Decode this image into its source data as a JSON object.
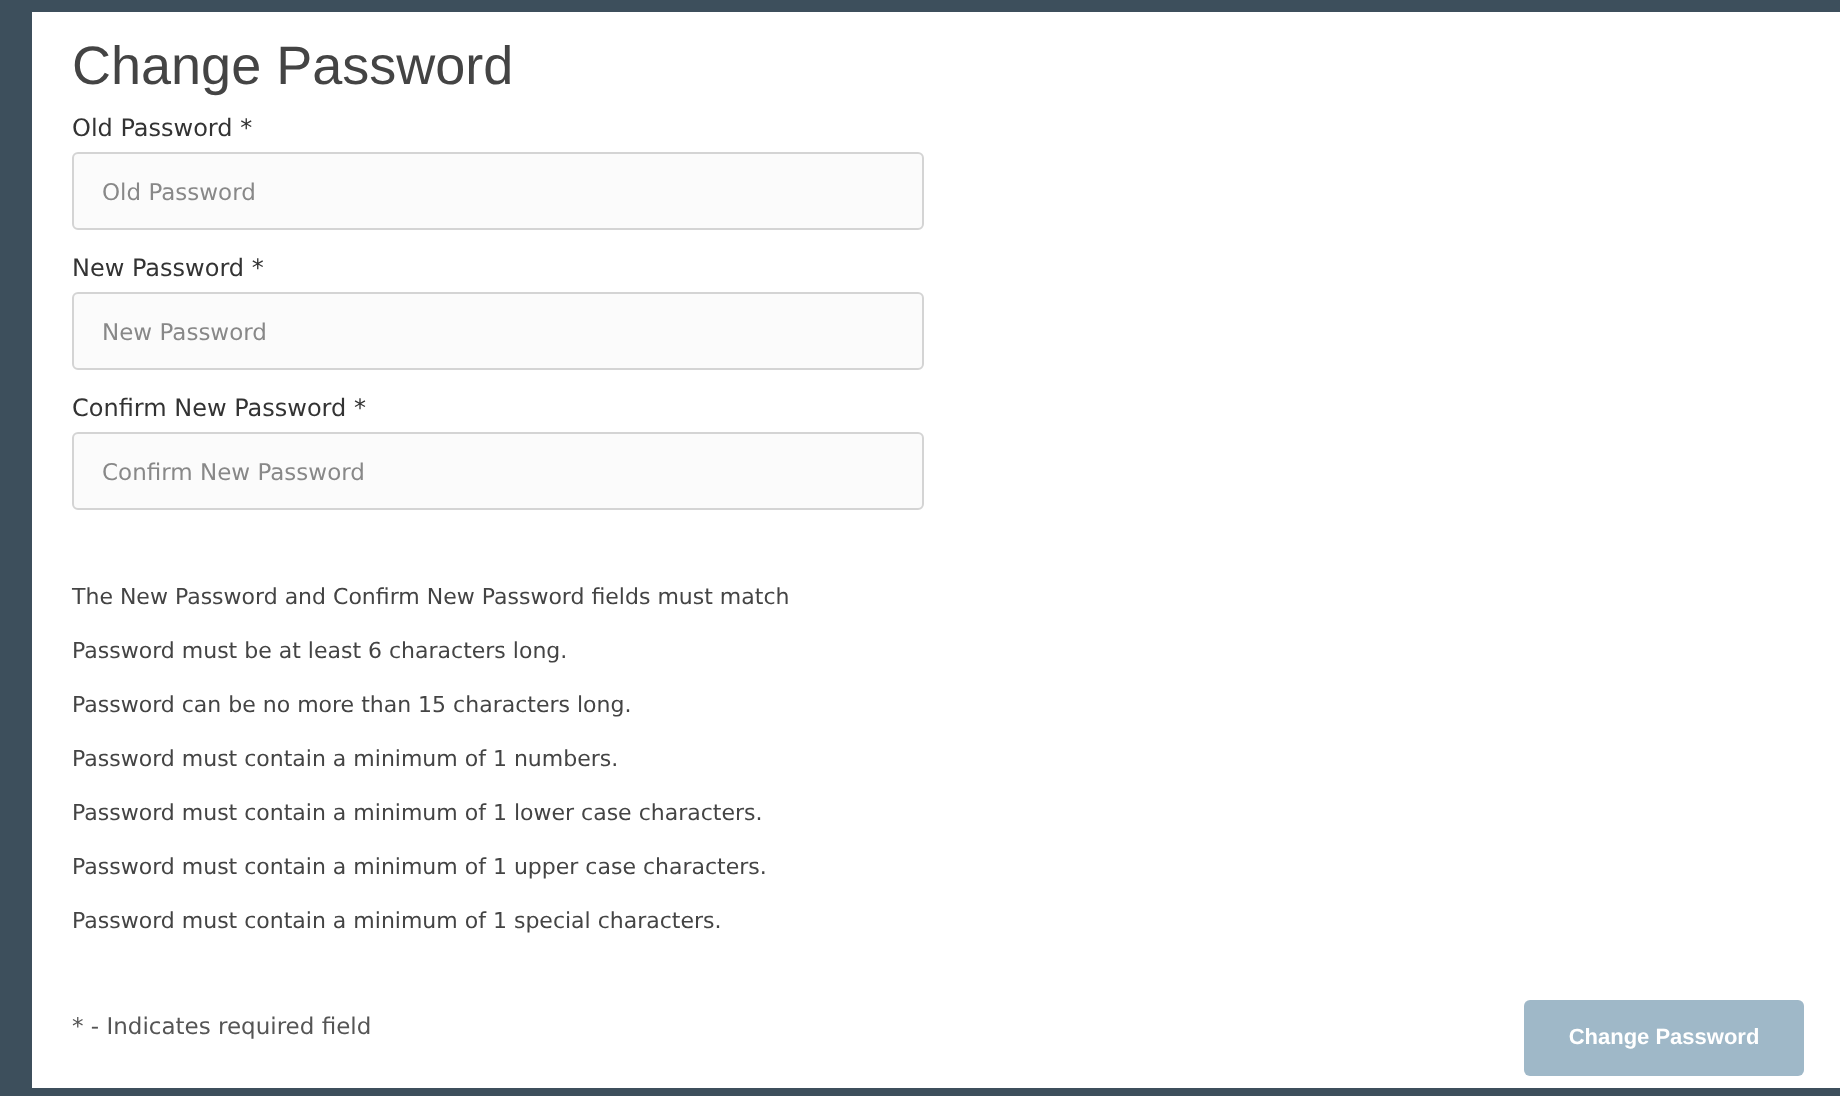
{
  "title": "Change Password",
  "fields": [
    {
      "label": "Old Password *",
      "placeholder": "Old Password"
    },
    {
      "label": "New Password *",
      "placeholder": "New Password"
    },
    {
      "label": "Confirm New Password *",
      "placeholder": "Confirm New Password"
    }
  ],
  "rules": [
    "The New Password and Confirm New Password fields must match",
    "Password must be at least 6 characters long.",
    "Password can be no more than 15 characters long.",
    "Password must contain a minimum of 1 numbers.",
    "Password must contain a minimum of 1 lower case characters.",
    "Password must contain a minimum of 1 upper case characters.",
    "Password must contain a minimum of 1 special characters."
  ],
  "required_note": "* - Indicates required field",
  "submit": {
    "label": "Change Password",
    "disabled": true
  }
}
